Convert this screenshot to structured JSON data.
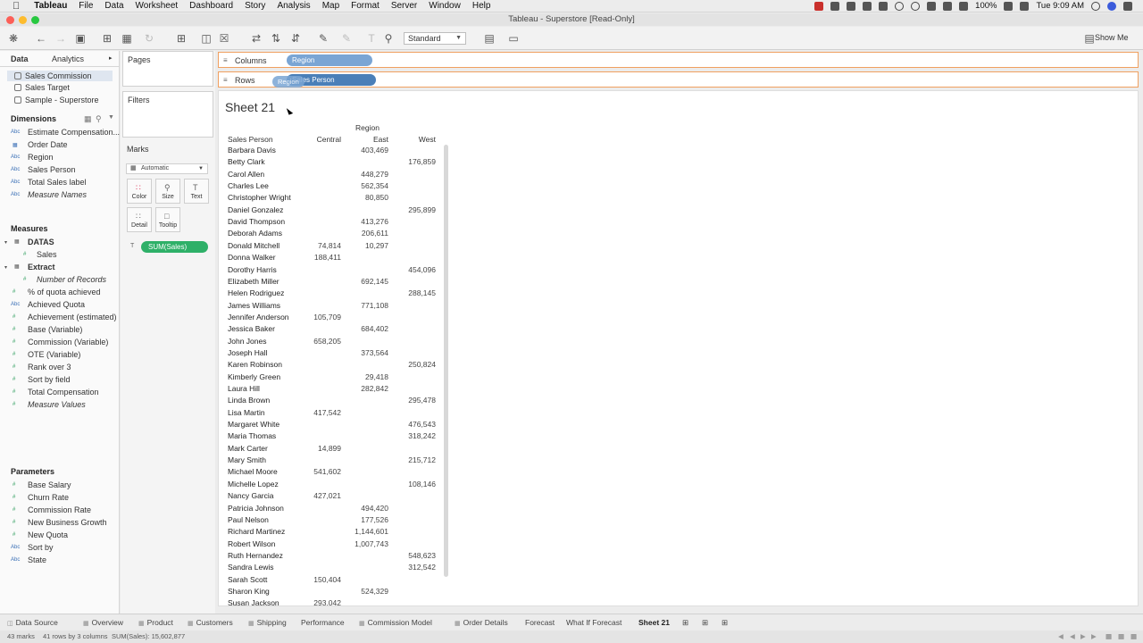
{
  "menubar": {
    "app": "Tableau",
    "items": [
      "File",
      "Data",
      "Worksheet",
      "Dashboard",
      "Story",
      "Analysis",
      "Map",
      "Format",
      "Server",
      "Window",
      "Help"
    ],
    "battery": "100%",
    "clock": "Tue 9:09 AM"
  },
  "window": {
    "title": "Tableau - Superstore [Read-Only]"
  },
  "toolbar": {
    "fit": "Standard",
    "show_me": "Show Me"
  },
  "left": {
    "tabs": [
      "Data",
      "Analytics"
    ],
    "datasources": [
      "Sales Commission",
      "Sales Target",
      "Sample - Superstore"
    ],
    "dimensions_title": "Dimensions",
    "dimensions": [
      "Estimate Compensation...",
      "Order Date",
      "Region",
      "Sales Person",
      "Total Sales label",
      "Measure Names"
    ],
    "measures_title": "Measures",
    "measures_groups": [
      {
        "name": "DATAS",
        "fields": [
          "Sales"
        ]
      },
      {
        "name": "Extract",
        "fields": [
          "Number of Records"
        ]
      }
    ],
    "measures": [
      "% of quota achieved",
      "Achieved Quota",
      "Achievement (estimated)",
      "Base (Variable)",
      "Commission (Variable)",
      "OTE (Variable)",
      "Rank over 3",
      "Sort by field",
      "Total Compensation",
      "Measure Values"
    ],
    "parameters_title": "Parameters",
    "parameters": [
      "Base Salary",
      "Churn Rate",
      "Commission Rate",
      "New Business Growth",
      "New Quota",
      "Sort by",
      "State"
    ]
  },
  "cards": {
    "pages": "Pages",
    "filters": "Filters",
    "marks": "Marks",
    "mark_type": "Automatic",
    "buttons": [
      "Color",
      "Size",
      "Text",
      "Detail",
      "Tooltip"
    ],
    "pill": "SUM(Sales)"
  },
  "shelves": {
    "columns_label": "Columns",
    "rows_label": "Rows",
    "columns_pill": "Region",
    "rows_pill": "Sales Person",
    "drag_pill": "Region"
  },
  "view": {
    "title": "Sheet 21",
    "col_group": "Region",
    "row_header": "Sales Person",
    "columns": [
      "Central",
      "East",
      "West"
    ],
    "rows": [
      [
        "Barbara Davis",
        "",
        "403,469",
        ""
      ],
      [
        "Betty Clark",
        "",
        "",
        "176,859"
      ],
      [
        "Carol Allen",
        "",
        "448,279",
        ""
      ],
      [
        "Charles Lee",
        "",
        "562,354",
        ""
      ],
      [
        "Christopher Wright",
        "",
        "80,850",
        ""
      ],
      [
        "Daniel Gonzalez",
        "",
        "",
        "295,899"
      ],
      [
        "David Thompson",
        "",
        "413,276",
        ""
      ],
      [
        "Deborah Adams",
        "",
        "206,611",
        ""
      ],
      [
        "Donald Mitchell",
        "74,814",
        "10,297",
        ""
      ],
      [
        "Donna Walker",
        "188,411",
        "",
        ""
      ],
      [
        "Dorothy Harris",
        "",
        "",
        "454,096"
      ],
      [
        "Elizabeth Miller",
        "",
        "692,145",
        ""
      ],
      [
        "Helen Rodriguez",
        "",
        "",
        "288,145"
      ],
      [
        "James Williams",
        "",
        "771,108",
        ""
      ],
      [
        "Jennifer Anderson",
        "105,709",
        "",
        ""
      ],
      [
        "Jessica Baker",
        "",
        "684,402",
        ""
      ],
      [
        "John Jones",
        "658,205",
        "",
        ""
      ],
      [
        "Joseph Hall",
        "",
        "373,564",
        ""
      ],
      [
        "Karen Robinson",
        "",
        "",
        "250,824"
      ],
      [
        "Kimberly Green",
        "",
        "29,418",
        ""
      ],
      [
        "Laura Hill",
        "",
        "282,842",
        ""
      ],
      [
        "Linda Brown",
        "",
        "",
        "295,478"
      ],
      [
        "Lisa Martin",
        "417,542",
        "",
        ""
      ],
      [
        "Margaret White",
        "",
        "",
        "476,543"
      ],
      [
        "Maria Thomas",
        "",
        "",
        "318,242"
      ],
      [
        "Mark Carter",
        "14,899",
        "",
        ""
      ],
      [
        "Mary Smith",
        "",
        "",
        "215,712"
      ],
      [
        "Michael Moore",
        "541,602",
        "",
        ""
      ],
      [
        "Michelle Lopez",
        "",
        "",
        "108,146"
      ],
      [
        "Nancy Garcia",
        "427,021",
        "",
        ""
      ],
      [
        "Patricia Johnson",
        "",
        "494,420",
        ""
      ],
      [
        "Paul Nelson",
        "",
        "177,526",
        ""
      ],
      [
        "Richard Martinez",
        "",
        "1,144,601",
        ""
      ],
      [
        "Robert Wilson",
        "",
        "1,007,743",
        ""
      ],
      [
        "Ruth Hernandez",
        "",
        "",
        "548,623"
      ],
      [
        "Sandra Lewis",
        "",
        "",
        "312,542"
      ],
      [
        "Sarah Scott",
        "150,404",
        "",
        ""
      ],
      [
        "Sharon King",
        "",
        "524,329",
        ""
      ],
      [
        "Susan Jackson",
        "293,042",
        "",
        ""
      ]
    ]
  },
  "sheet_tabs": [
    "Data Source",
    "Overview",
    "Product",
    "Customers",
    "Shipping",
    "Performance",
    "Commission Model",
    "Order Details",
    "Forecast",
    "What If Forecast",
    "Sheet 21"
  ],
  "status": {
    "marks": "43 marks",
    "dims": "41 rows by 3 columns",
    "sum": "SUM(Sales): 15,602,877"
  }
}
